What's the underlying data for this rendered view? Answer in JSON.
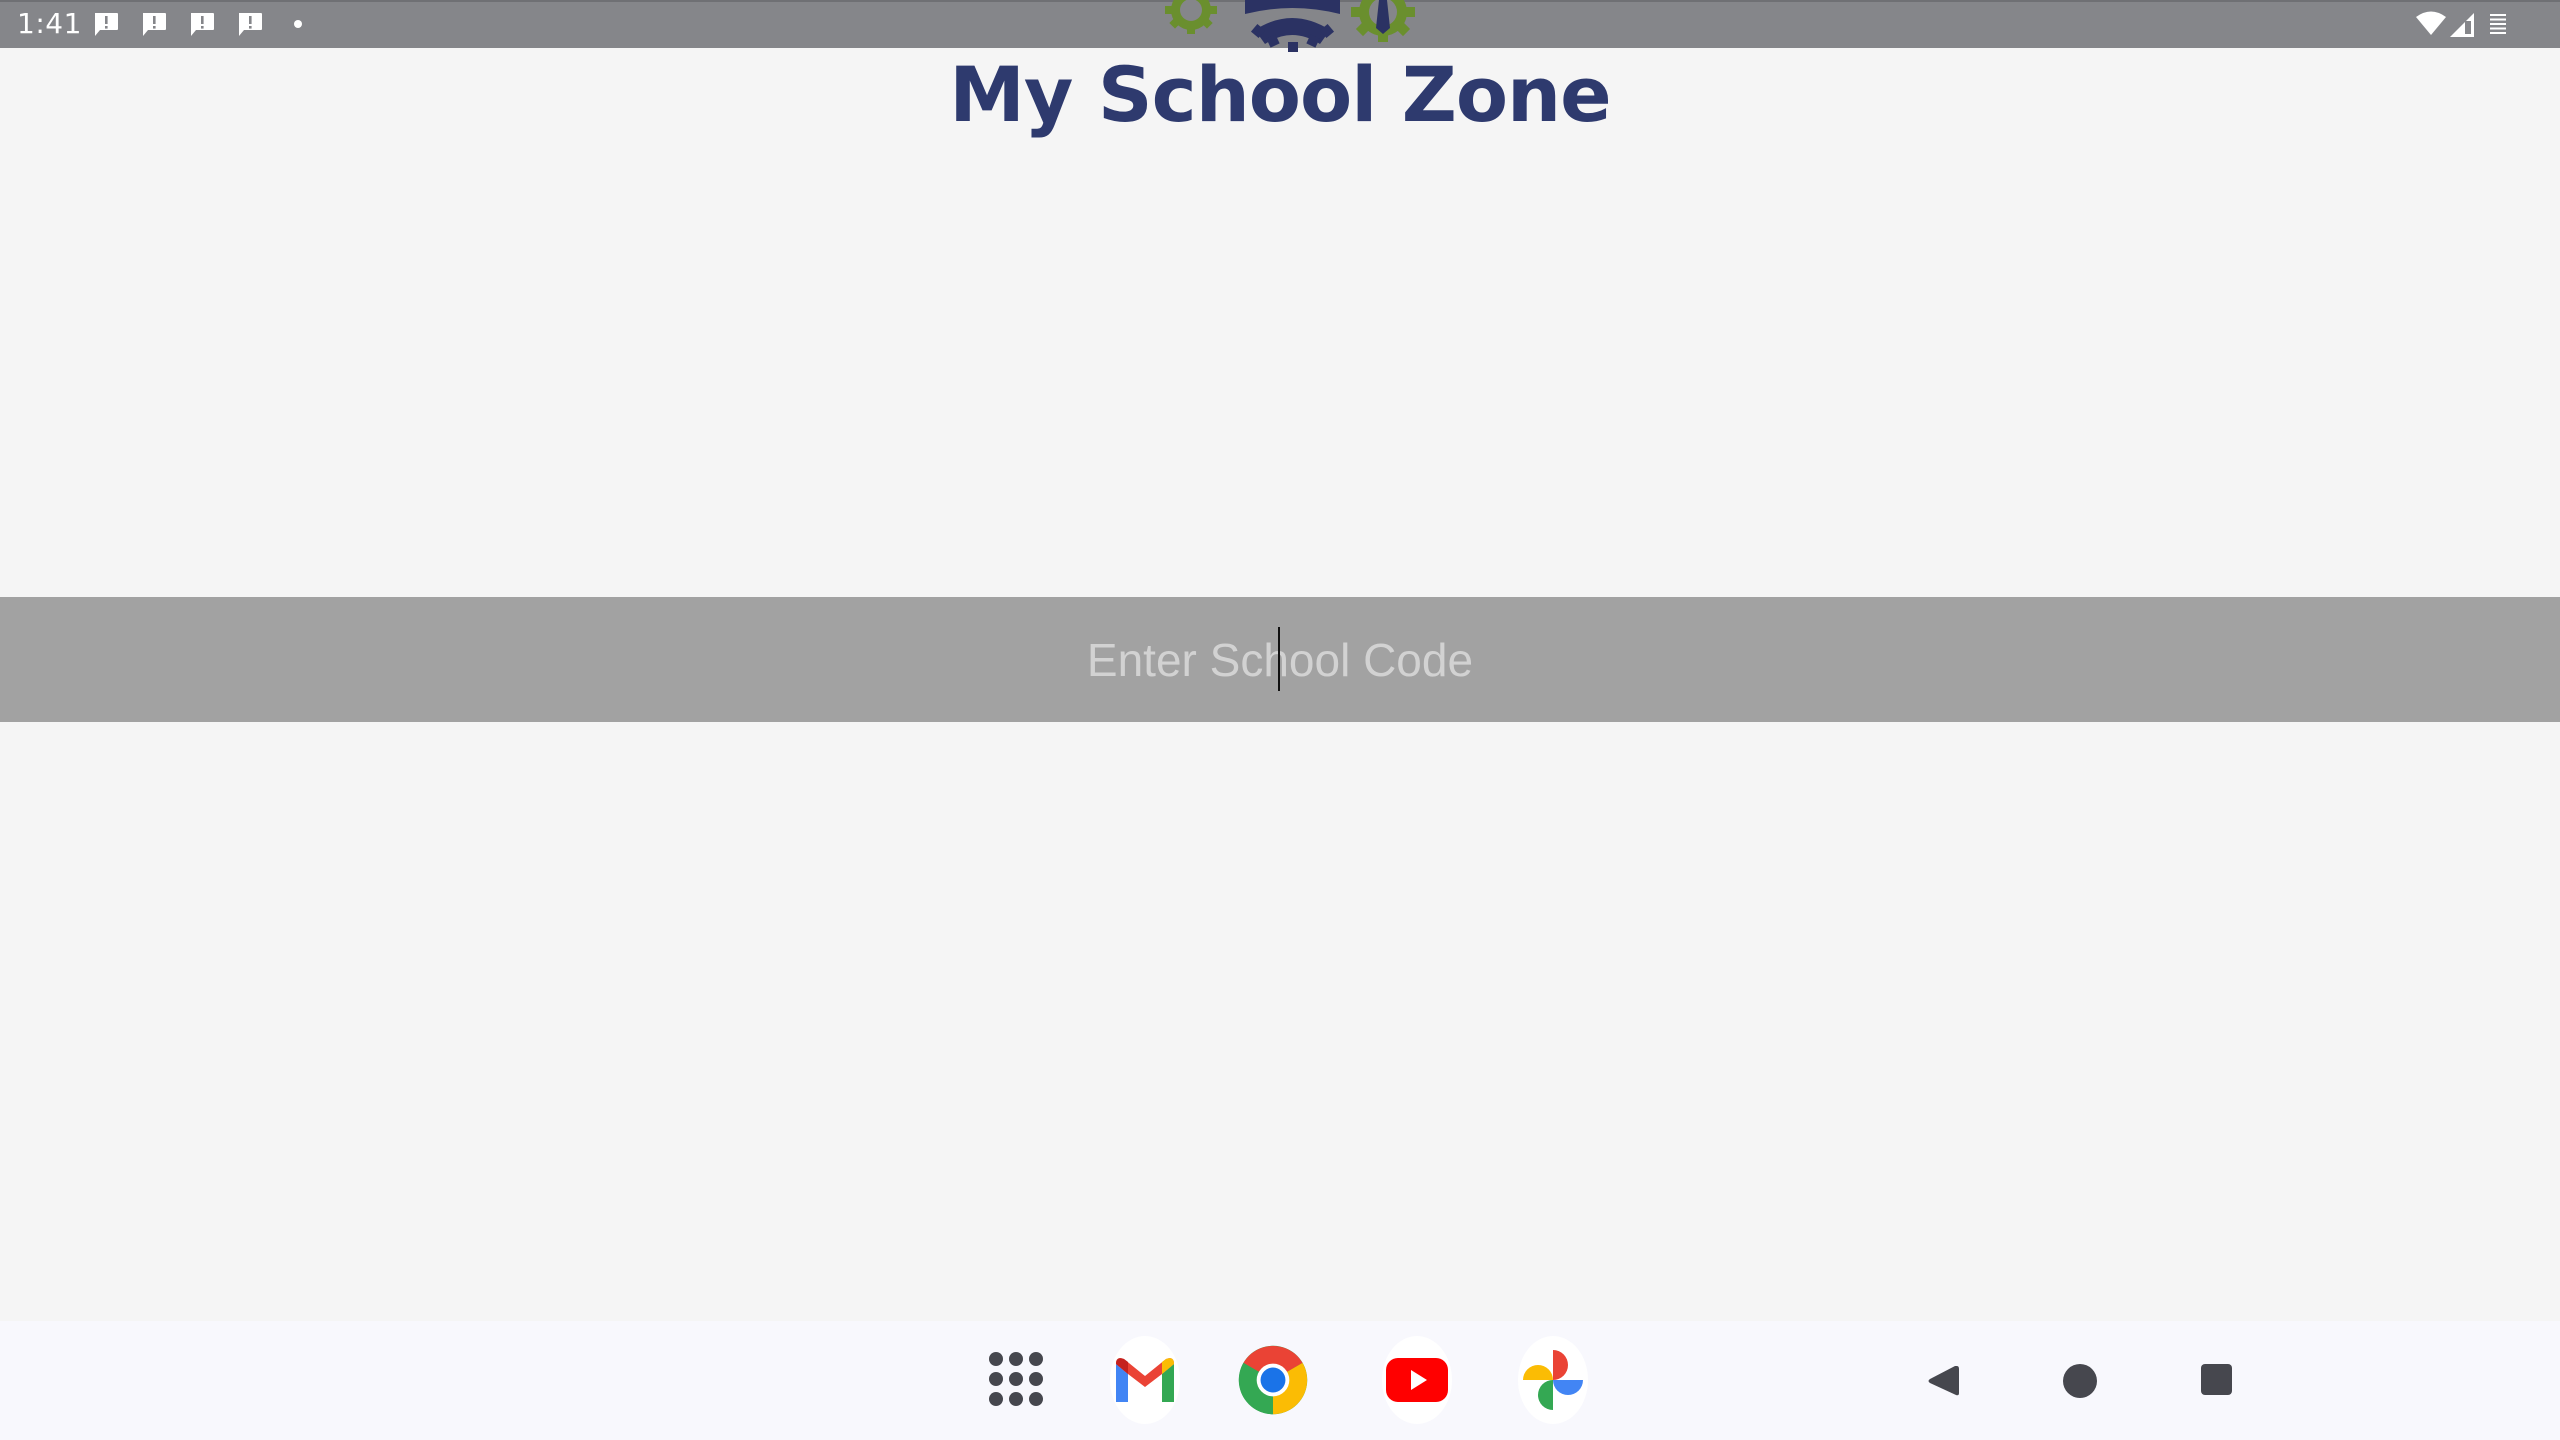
{
  "status_bar": {
    "time": "1:41",
    "notification_icons": [
      "alert-message-icon",
      "alert-message-icon",
      "alert-message-icon",
      "alert-message-icon",
      "more-notifications-dot"
    ],
    "system_icons": [
      "wifi-icon",
      "cellular-signal-icon",
      "battery-icon"
    ]
  },
  "app": {
    "title": "My School Zone",
    "logo": "school-gears-emblem",
    "brand_colors": {
      "navy": "#2e3a6e",
      "green": "#6a8f2e"
    }
  },
  "school_code": {
    "placeholder": "Enter School Code",
    "value": ""
  },
  "taskbar": {
    "apps": [
      {
        "name": "All apps",
        "icon": "app-drawer-icon"
      },
      {
        "name": "Gmail",
        "icon": "gmail-icon"
      },
      {
        "name": "Chrome",
        "icon": "chrome-icon"
      },
      {
        "name": "YouTube",
        "icon": "youtube-icon"
      },
      {
        "name": "Photos",
        "icon": "photos-icon"
      }
    ],
    "nav": [
      {
        "name": "Back",
        "icon": "back-icon"
      },
      {
        "name": "Home",
        "icon": "home-icon"
      },
      {
        "name": "Recents",
        "icon": "recents-icon"
      }
    ]
  }
}
